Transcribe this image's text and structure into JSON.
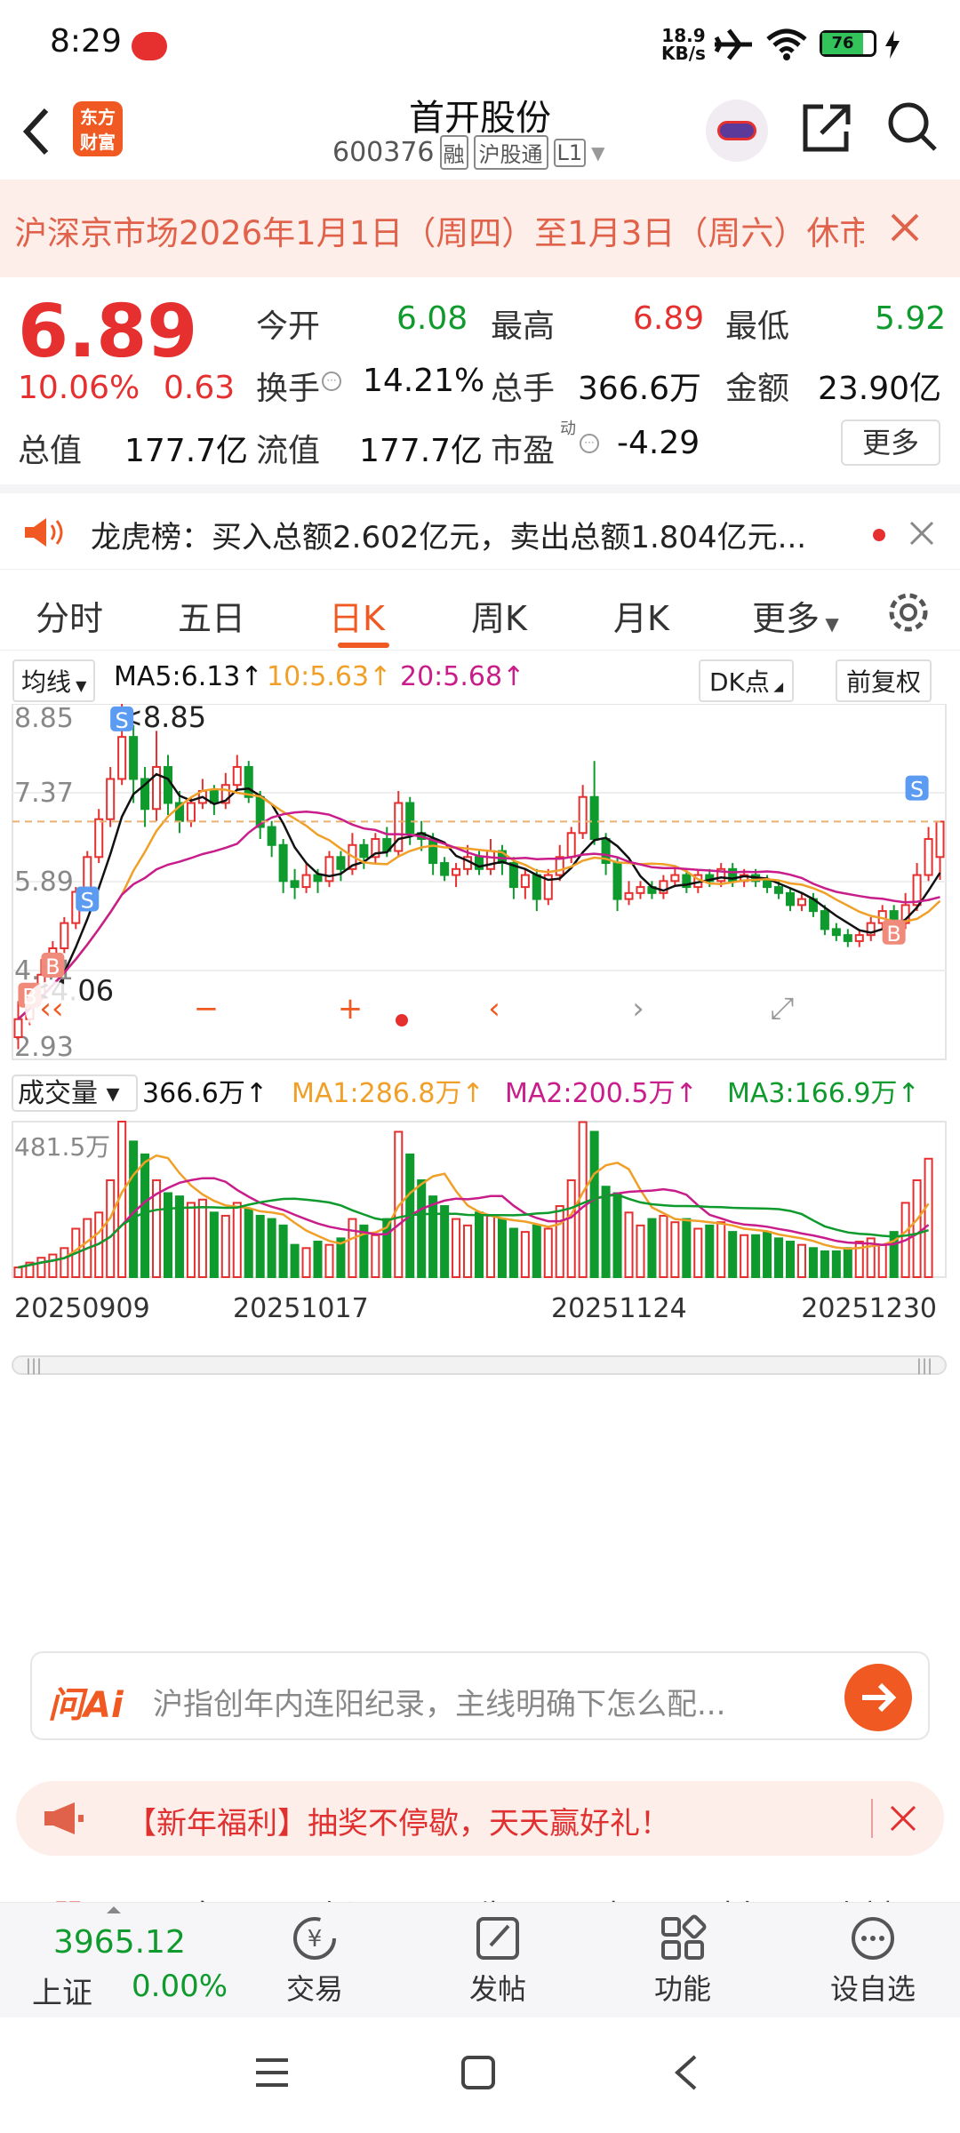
{
  "status": {
    "time": "8:29",
    "net_speed_top": "18.9",
    "net_speed_bottom": "KB/s",
    "battery": "76"
  },
  "header": {
    "title": "首开股份",
    "code": "600376",
    "badge_rong": "融",
    "badge_hgt": "沪股通",
    "badge_level": "L1",
    "logo_line1": "东方",
    "logo_line2": "财富"
  },
  "notice": {
    "text": "沪深京市场2026年1月1日（周四）至1月3日（周六）休市"
  },
  "quote": {
    "price": "6.89",
    "change_pct": "10.06%",
    "change_amt": "0.63",
    "open_label": "今开",
    "open": "6.08",
    "high_label": "最高",
    "high": "6.89",
    "low_label": "最低",
    "low": "5.92",
    "turnover_label": "换手",
    "turnover": "14.21%",
    "vol_label": "总手",
    "vol": "366.6万",
    "amount_label": "金额",
    "amount": "23.90亿",
    "mcap_label": "总值",
    "mcap": "177.7亿",
    "float_label": "流值",
    "float": "177.7亿",
    "pe_label": "市盈",
    "pe_sup": "动",
    "pe": "-4.29",
    "more": "更多"
  },
  "lhb": {
    "text": "龙虎榜：买入总额2.602亿元，卖出总额1.804亿元..."
  },
  "tabs": [
    "分时",
    "五日",
    "日K",
    "周K",
    "月K",
    "更多"
  ],
  "chart": {
    "ma_toggle": "均线",
    "ma5": "MA5:6.13↑",
    "ma10": "10:5.63↑",
    "ma20": "20:5.68↑",
    "dk": "DK点",
    "fq": "前复权",
    "y_labels": [
      "8.85",
      "7.37",
      "5.89",
      "4.41",
      "2.93"
    ],
    "high_mark": "<8.85",
    "low_mark": "<4.06",
    "vol_toggle": "成交量",
    "vol_value": "366.6万↑",
    "vma1": "MA1:286.8万↑",
    "vma2": "MA2:200.5万↑",
    "vma3": "MA3:166.9万↑",
    "vol_max": "481.5万",
    "dates": [
      "20250909",
      "20251017",
      "20251124",
      "20251230"
    ]
  },
  "chart_data": {
    "type": "candlestick",
    "ylim": [
      2.93,
      8.85
    ],
    "series": [
      {
        "o": 3.3,
        "c": 3.6,
        "h": 3.9,
        "l": 3.1
      },
      {
        "o": 3.6,
        "c": 3.95,
        "h": 4.2,
        "l": 3.5
      },
      {
        "o": 3.95,
        "c": 4.34,
        "h": 4.6,
        "l": 3.9
      },
      {
        "o": 4.34,
        "c": 4.78,
        "h": 4.9,
        "l": 4.3
      },
      {
        "o": 4.78,
        "c": 5.2,
        "h": 5.3,
        "l": 4.7
      },
      {
        "o": 5.2,
        "c": 5.72,
        "h": 5.8,
        "l": 5.1
      },
      {
        "o": 5.72,
        "c": 6.3,
        "h": 6.4,
        "l": 5.6
      },
      {
        "o": 6.3,
        "c": 6.93,
        "h": 7.1,
        "l": 6.2
      },
      {
        "o": 6.93,
        "c": 7.6,
        "h": 7.8,
        "l": 6.8
      },
      {
        "o": 7.6,
        "c": 8.3,
        "h": 8.85,
        "l": 7.5
      },
      {
        "o": 8.3,
        "c": 7.6,
        "h": 8.5,
        "l": 7.2
      },
      {
        "o": 7.6,
        "c": 7.1,
        "h": 7.8,
        "l": 6.8
      },
      {
        "o": 7.1,
        "c": 7.8,
        "h": 8.4,
        "l": 6.9
      },
      {
        "o": 7.8,
        "c": 7.2,
        "h": 8.0,
        "l": 7.0
      },
      {
        "o": 7.2,
        "c": 6.9,
        "h": 7.4,
        "l": 6.7
      },
      {
        "o": 6.9,
        "c": 7.2,
        "h": 7.3,
        "l": 6.8
      },
      {
        "o": 7.2,
        "c": 7.4,
        "h": 7.6,
        "l": 7.1
      },
      {
        "o": 7.4,
        "c": 7.2,
        "h": 7.5,
        "l": 7.0
      },
      {
        "o": 7.2,
        "c": 7.5,
        "h": 7.7,
        "l": 7.1
      },
      {
        "o": 7.5,
        "c": 7.8,
        "h": 8.0,
        "l": 7.4
      },
      {
        "o": 7.8,
        "c": 7.3,
        "h": 7.9,
        "l": 7.2
      },
      {
        "o": 7.3,
        "c": 6.8,
        "h": 7.4,
        "l": 6.6
      },
      {
        "o": 6.8,
        "c": 6.5,
        "h": 6.9,
        "l": 6.3
      },
      {
        "o": 6.5,
        "c": 5.9,
        "h": 6.6,
        "l": 5.7
      },
      {
        "o": 5.9,
        "c": 5.8,
        "h": 6.1,
        "l": 5.6
      },
      {
        "o": 5.8,
        "c": 6.0,
        "h": 6.2,
        "l": 5.7
      },
      {
        "o": 6.0,
        "c": 5.9,
        "h": 6.1,
        "l": 5.7
      },
      {
        "o": 5.9,
        "c": 6.3,
        "h": 6.4,
        "l": 5.8
      },
      {
        "o": 6.3,
        "c": 6.1,
        "h": 6.4,
        "l": 5.9
      },
      {
        "o": 6.1,
        "c": 6.5,
        "h": 6.7,
        "l": 6.0
      },
      {
        "o": 6.5,
        "c": 6.3,
        "h": 6.6,
        "l": 6.1
      },
      {
        "o": 6.3,
        "c": 6.6,
        "h": 6.7,
        "l": 6.2
      },
      {
        "o": 6.6,
        "c": 6.4,
        "h": 6.8,
        "l": 6.3
      },
      {
        "o": 6.4,
        "c": 7.2,
        "h": 7.4,
        "l": 6.3
      },
      {
        "o": 7.2,
        "c": 6.7,
        "h": 7.3,
        "l": 6.5
      },
      {
        "o": 6.7,
        "c": 6.6,
        "h": 6.9,
        "l": 6.4
      },
      {
        "o": 6.6,
        "c": 6.2,
        "h": 6.7,
        "l": 6.0
      },
      {
        "o": 6.2,
        "c": 6.0,
        "h": 6.3,
        "l": 5.9
      },
      {
        "o": 6.0,
        "c": 6.1,
        "h": 6.2,
        "l": 5.8
      },
      {
        "o": 6.1,
        "c": 6.3,
        "h": 6.5,
        "l": 6.0
      },
      {
        "o": 6.3,
        "c": 6.1,
        "h": 6.4,
        "l": 6.0
      },
      {
        "o": 6.1,
        "c": 6.4,
        "h": 6.6,
        "l": 6.0
      },
      {
        "o": 6.4,
        "c": 6.2,
        "h": 6.5,
        "l": 6.0
      },
      {
        "o": 6.2,
        "c": 5.8,
        "h": 6.3,
        "l": 5.6
      },
      {
        "o": 5.8,
        "c": 6.0,
        "h": 6.1,
        "l": 5.6
      },
      {
        "o": 6.0,
        "c": 5.6,
        "h": 6.1,
        "l": 5.4
      },
      {
        "o": 5.6,
        "c": 6.0,
        "h": 6.1,
        "l": 5.5
      },
      {
        "o": 6.0,
        "c": 6.3,
        "h": 6.5,
        "l": 5.9
      },
      {
        "o": 6.3,
        "c": 6.7,
        "h": 6.8,
        "l": 6.2
      },
      {
        "o": 6.7,
        "c": 7.3,
        "h": 7.5,
        "l": 6.6
      },
      {
        "o": 7.3,
        "c": 6.6,
        "h": 7.9,
        "l": 6.5
      },
      {
        "o": 6.6,
        "c": 6.2,
        "h": 6.7,
        "l": 6.0
      },
      {
        "o": 6.2,
        "c": 5.6,
        "h": 6.3,
        "l": 5.4
      },
      {
        "o": 5.6,
        "c": 5.7,
        "h": 5.9,
        "l": 5.5
      },
      {
        "o": 5.7,
        "c": 5.8,
        "h": 5.9,
        "l": 5.6
      },
      {
        "o": 5.8,
        "c": 5.7,
        "h": 5.9,
        "l": 5.6
      },
      {
        "o": 5.7,
        "c": 5.9,
        "h": 6.0,
        "l": 5.6
      },
      {
        "o": 5.9,
        "c": 6.0,
        "h": 6.1,
        "l": 5.8
      },
      {
        "o": 6.0,
        "c": 5.8,
        "h": 6.1,
        "l": 5.7
      },
      {
        "o": 5.8,
        "c": 6.0,
        "h": 6.1,
        "l": 5.7
      },
      {
        "o": 6.0,
        "c": 5.9,
        "h": 6.1,
        "l": 5.8
      },
      {
        "o": 5.9,
        "c": 6.1,
        "h": 6.2,
        "l": 5.8
      },
      {
        "o": 6.1,
        "c": 5.9,
        "h": 6.2,
        "l": 5.8
      },
      {
        "o": 5.9,
        "c": 6.0,
        "h": 6.1,
        "l": 5.8
      },
      {
        "o": 6.0,
        "c": 5.9,
        "h": 6.1,
        "l": 5.8
      },
      {
        "o": 5.9,
        "c": 5.8,
        "h": 6.0,
        "l": 5.7
      },
      {
        "o": 5.8,
        "c": 5.7,
        "h": 5.9,
        "l": 5.6
      },
      {
        "o": 5.7,
        "c": 5.5,
        "h": 5.8,
        "l": 5.4
      },
      {
        "o": 5.5,
        "c": 5.6,
        "h": 5.7,
        "l": 5.4
      },
      {
        "o": 5.6,
        "c": 5.4,
        "h": 5.7,
        "l": 5.3
      },
      {
        "o": 5.4,
        "c": 5.1,
        "h": 5.5,
        "l": 5.0
      },
      {
        "o": 5.1,
        "c": 5.0,
        "h": 5.2,
        "l": 4.9
      },
      {
        "o": 5.0,
        "c": 4.9,
        "h": 5.1,
        "l": 4.8
      },
      {
        "o": 4.9,
        "c": 5.0,
        "h": 5.1,
        "l": 4.8
      },
      {
        "o": 5.0,
        "c": 5.2,
        "h": 5.3,
        "l": 4.9
      },
      {
        "o": 5.2,
        "c": 5.4,
        "h": 5.5,
        "l": 5.1
      },
      {
        "o": 5.4,
        "c": 5.2,
        "h": 5.5,
        "l": 5.1
      },
      {
        "o": 5.2,
        "c": 5.5,
        "h": 5.7,
        "l": 5.1
      },
      {
        "o": 5.5,
        "c": 6.0,
        "h": 6.2,
        "l": 5.4
      },
      {
        "o": 6.0,
        "c": 6.6,
        "h": 6.8,
        "l": 5.9
      },
      {
        "o": 6.3,
        "c": 6.89,
        "h": 6.89,
        "l": 5.92
      }
    ],
    "volumes": [
      30,
      45,
      60,
      70,
      90,
      150,
      180,
      200,
      300,
      481.5,
      420,
      380,
      300,
      260,
      250,
      230,
      240,
      200,
      190,
      230,
      210,
      190,
      180,
      160,
      100,
      90,
      110,
      100,
      120,
      180,
      160,
      130,
      180,
      450,
      380,
      300,
      250,
      220,
      180,
      160,
      200,
      190,
      180,
      150,
      140,
      160,
      150,
      220,
      300,
      480,
      450,
      280,
      260,
      200,
      160,
      180,
      190,
      170,
      180,
      150,
      160,
      170,
      140,
      130,
      130,
      140,
      120,
      110,
      100,
      90,
      80,
      80,
      90,
      110,
      120,
      100,
      140,
      230,
      300,
      366.6
    ],
    "vol_ylim": [
      0,
      481.5
    ]
  },
  "ai": {
    "logo": "问Ai",
    "text": "沪指创年内连阳纪录，主线明确下怎么配..."
  },
  "promo": {
    "text": "【新年福利】抽奖不停歇，天天赢好礼！"
  },
  "sections": [
    "股吧",
    "盘口",
    "资讯",
    "公告",
    "研报",
    "财务",
    "资料"
  ],
  "bottom": {
    "index_value": "3965.12",
    "index_name": "上证",
    "index_change": "0.00%",
    "items": [
      "交易",
      "发帖",
      "功能",
      "设自选"
    ]
  }
}
